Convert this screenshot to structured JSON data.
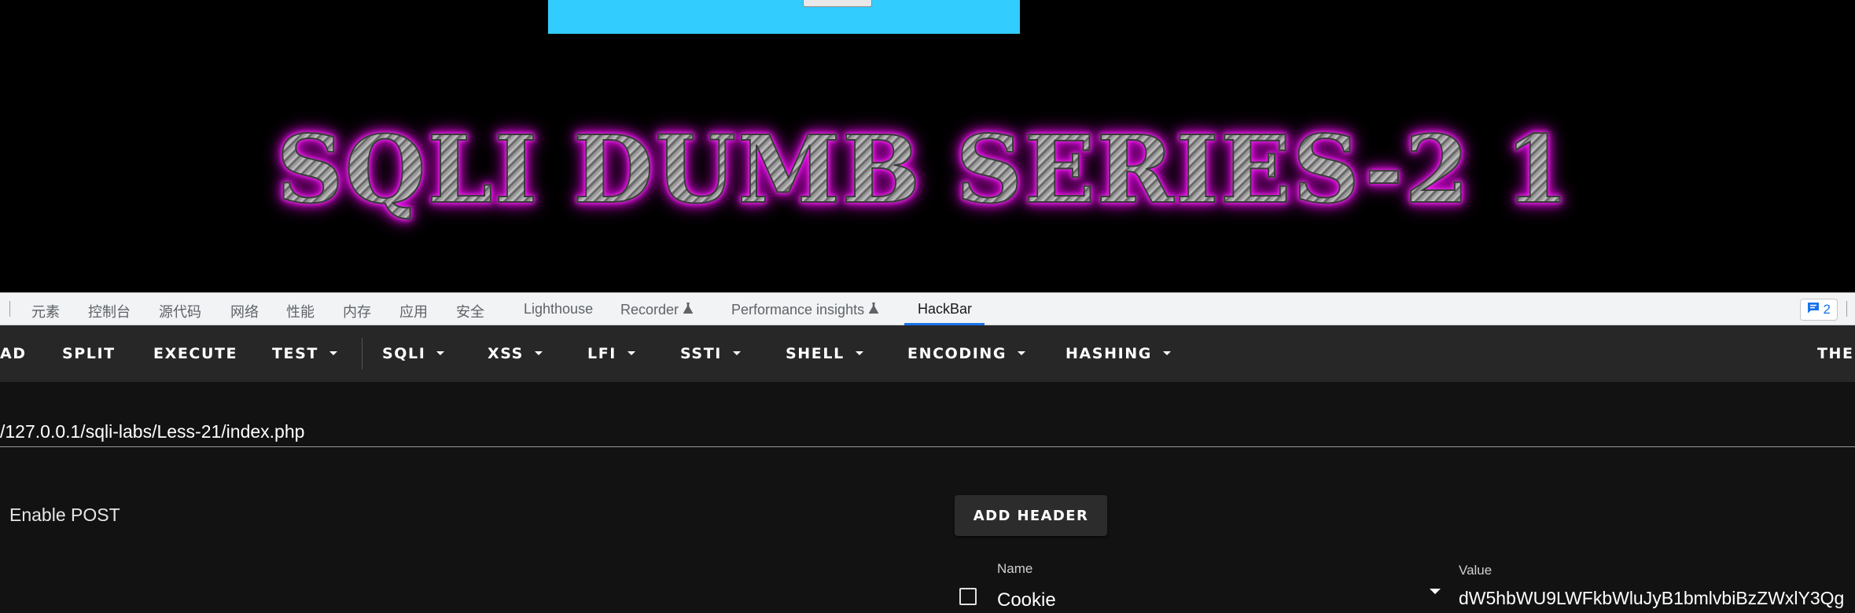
{
  "page": {
    "banner_title": "SQLI DUMB SERIES-2 1",
    "colors": {
      "panel": "#33ccff",
      "banner_glow": "#d000d0",
      "background": "#000000"
    }
  },
  "devtools": {
    "tabs": [
      {
        "label": "元素"
      },
      {
        "label": "控制台"
      },
      {
        "label": "源代码"
      },
      {
        "label": "网络"
      },
      {
        "label": "性能"
      },
      {
        "label": "内存"
      },
      {
        "label": "应用"
      },
      {
        "label": "安全"
      },
      {
        "label": "Lighthouse"
      },
      {
        "label": "Recorder",
        "icon": "flask-icon"
      },
      {
        "label": "Performance insights",
        "icon": "flask-icon"
      },
      {
        "label": "HackBar",
        "active": true
      }
    ],
    "issues_count": "2",
    "accent": "#1a73e8"
  },
  "hackbar": {
    "toolbar": {
      "load": "AD",
      "split": "SPLIT",
      "execute": "EXECUTE",
      "test": "TEST",
      "sqli": "SQLI",
      "xss": "XSS",
      "lfi": "LFI",
      "ssti": "SSTI",
      "shell": "SHELL",
      "encoding": "ENCODING",
      "hashing": "HASHING",
      "theme": "THEI"
    },
    "url": "/127.0.0.1/sqli-labs/Less-21/index.php",
    "enable_post_label": "Enable POST",
    "add_header_label": "ADD HEADER",
    "header": {
      "name_label": "Name",
      "name_value": "Cookie",
      "value_label": "Value",
      "value_value": "dW5hbWU9LWFkbWluJyB1bmlvbiBzZWxlY3Qg",
      "enabled": false
    }
  }
}
